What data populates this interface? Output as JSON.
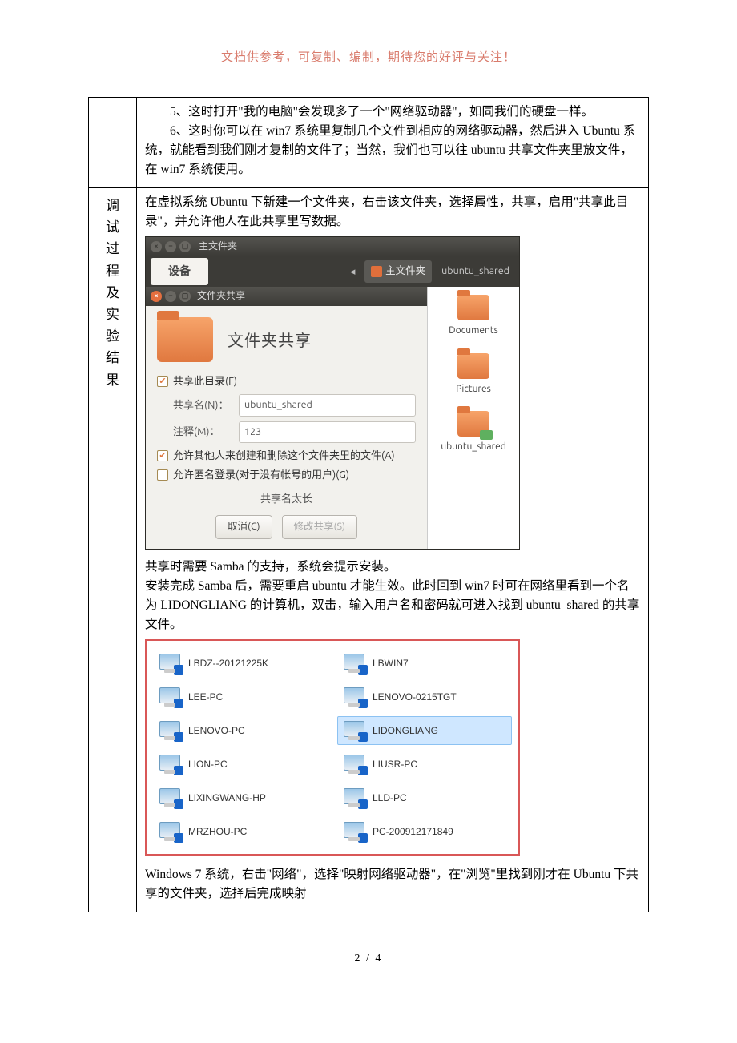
{
  "header_note": "文档供参考，可复制、编制，期待您的好评与关注！",
  "row1": {
    "p1": "5、这时打开\"我的电脑\"会发现多了一个\"网络驱动器\"，如同我们的硬盘一样。",
    "p2": "6、这时你可以在 win7 系统里复制几个文件到相应的网络驱动器，然后进入 Ubuntu 系统，就能看到我们刚才复制的文件了；当然，我们也可以往 ubuntu 共享文件夹里放文件，在 win7 系统使用。"
  },
  "sidebar": {
    "c1": "调",
    "c2": "试",
    "c3": "过",
    "c4": "程",
    "c5": "及",
    "c6": "实",
    "c7": "验",
    "c8": "结",
    "c9": "果"
  },
  "row2": {
    "intro": "在虚拟系统 Ubuntu 下新建一个文件夹，右击该文件夹，选择属性，共享，启用\"共享此目录\"，并允许他人在此共享里写数据。",
    "ubuntu": {
      "main_title": "主文件夹",
      "device_tab": "设备",
      "crumb_main": "主文件夹",
      "crumb_shared": "ubuntu_shared",
      "share_win_title": "文件夹共享",
      "share_heading": "文件夹共享",
      "cb_share": "共享此目录(F)",
      "lbl_name": "共享名(N)：",
      "val_name": "ubuntu_shared",
      "lbl_comment": "注释(M)：",
      "val_comment": "123",
      "cb_allow_write": "允许其他人来创建和删除这个文件夹里的文件(A)",
      "cb_anon": "允许匿名登录(对于没有帐号的用户)(G)",
      "warn": "共享名太长",
      "btn_cancel": "取消(C)",
      "btn_apply": "修改共享(S)",
      "files": {
        "documents": "Documents",
        "pictures": "Pictures",
        "shared": "ubuntu_shared"
      }
    },
    "mid1": "共享时需要 Samba 的支持，系统会提示安装。",
    "mid2": "安装完成 Samba 后，需要重启 ubuntu 才能生效。此时回到 win7 时可在网络里看到一个名为 LIDONGLIANG 的计算机，双击，输入用户名和密码就可进入找到 ubuntu_shared 的共享文件。",
    "net": {
      "c0": "LBDZ--20121225K",
      "c1": "LBWIN7",
      "c2": "LEE-PC",
      "c3": "LENOVO-0215TGT",
      "c4": "LENOVO-PC",
      "c5": "LIDONGLIANG",
      "c6": "LION-PC",
      "c7": "LIUSR-PC",
      "c8": "LIXINGWANG-HP",
      "c9": "LLD-PC",
      "c10": "MRZHOU-PC",
      "c11": "PC-200912171849"
    },
    "tail": "Windows 7 系统，右击\"网络\"，选择\"映射网络驱动器\"，在\"浏览\"里找到刚才在 Ubuntu 下共享的文件夹，选择后完成映射"
  },
  "page_num": "2 / 4"
}
